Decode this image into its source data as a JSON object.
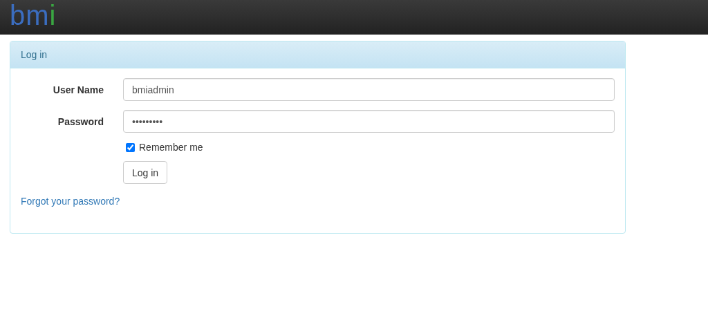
{
  "navbar": {
    "logo": [
      {
        "text": "bm",
        "color": "#3b6dbf"
      },
      {
        "text": "i",
        "color": "#3aa642"
      }
    ]
  },
  "panel": {
    "title": "Log in",
    "fields": [
      {
        "label": "User Name",
        "value": "bmiadmin"
      },
      {
        "label": "Password",
        "value": "•••••••••"
      }
    ],
    "remember": {
      "label": "Remember me",
      "checked": true
    },
    "button": "Log in",
    "link": "Forgot your password?"
  }
}
